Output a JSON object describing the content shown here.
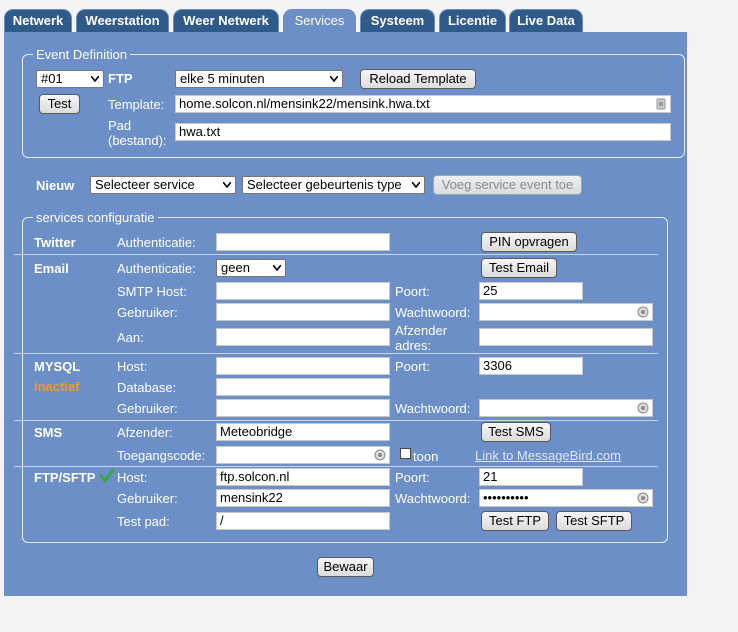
{
  "tabs": [
    {
      "label": "Netwerk",
      "active": false
    },
    {
      "label": "Weerstation",
      "active": false
    },
    {
      "label": "Weer Netwerk",
      "active": false
    },
    {
      "label": "Services",
      "active": true
    },
    {
      "label": "Systeem",
      "active": false
    },
    {
      "label": "Licentie",
      "active": false
    },
    {
      "label": "Live Data",
      "active": false
    }
  ],
  "event_definition": {
    "legend": "Event Definition",
    "event_select": "#01",
    "type_label": "FTP",
    "interval_select": "elke 5 minuten",
    "reload_button": "Reload Template",
    "test_button": "Test",
    "template_label": "Template:",
    "template_value": "home.solcon.nl/mensink22/mensink.hwa.txt",
    "pad_label_line1": "Pad",
    "pad_label_line2": "(bestand):",
    "pad_value": "hwa.txt"
  },
  "new_event": {
    "label": "Nieuw",
    "service_select": "Selecteer service",
    "event_select": "Selecteer gebeurtenis type",
    "add_button": "Voeg service event toe"
  },
  "services": {
    "legend": "services configuratie",
    "twitter": {
      "name": "Twitter",
      "auth_label": "Authenticatie:",
      "auth_value": "",
      "pin_button": "PIN opvragen"
    },
    "email": {
      "name": "Email",
      "auth_label": "Authenticatie:",
      "auth_select": "geen",
      "test_button": "Test Email",
      "smtp_label": "SMTP Host:",
      "smtp_value": "",
      "port_label": "Poort:",
      "port_value": "25",
      "user_label": "Gebruiker:",
      "user_value": "",
      "password_label": "Wachtwoord:",
      "password_value": "",
      "to_label": "Aan:",
      "to_value": "",
      "sender_label_line1": "Afzender",
      "sender_label_line2": "adres:",
      "sender_value": ""
    },
    "mysql": {
      "name": "MYSQL",
      "status": "inactief",
      "host_label": "Host:",
      "host_value": "",
      "port_label": "Poort:",
      "port_value": "3306",
      "db_label": "Database:",
      "db_value": "",
      "user_label": "Gebruiker:",
      "user_value": "",
      "password_label": "Wachtwoord:",
      "password_value": ""
    },
    "sms": {
      "name": "SMS",
      "sender_label": "Afzender:",
      "sender_value": "Meteobridge",
      "test_button": "Test SMS",
      "code_label": "Toegangscode:",
      "code_value": "",
      "show_label": "toon",
      "link_text": "Link to MessageBird.com"
    },
    "ftp": {
      "name": "FTP/SFTP",
      "host_label": "Host:",
      "host_value": "ftp.solcon.nl",
      "port_label": "Poort:",
      "port_value": "21",
      "user_label": "Gebruiker:",
      "user_value": "mensink22",
      "password_label": "Wachtwoord:",
      "password_value": "••••••••••",
      "testpath_label": "Test pad:",
      "testpath_value": "/",
      "test_ftp_button": "Test FTP",
      "test_sftp_button": "Test SFTP"
    }
  },
  "save_button": "Bewaar",
  "colors": {
    "panel": "#6b8fc6",
    "tab": "#305a8a",
    "status_inactive": "#f39a2c",
    "check_ok": "#3aa544"
  }
}
